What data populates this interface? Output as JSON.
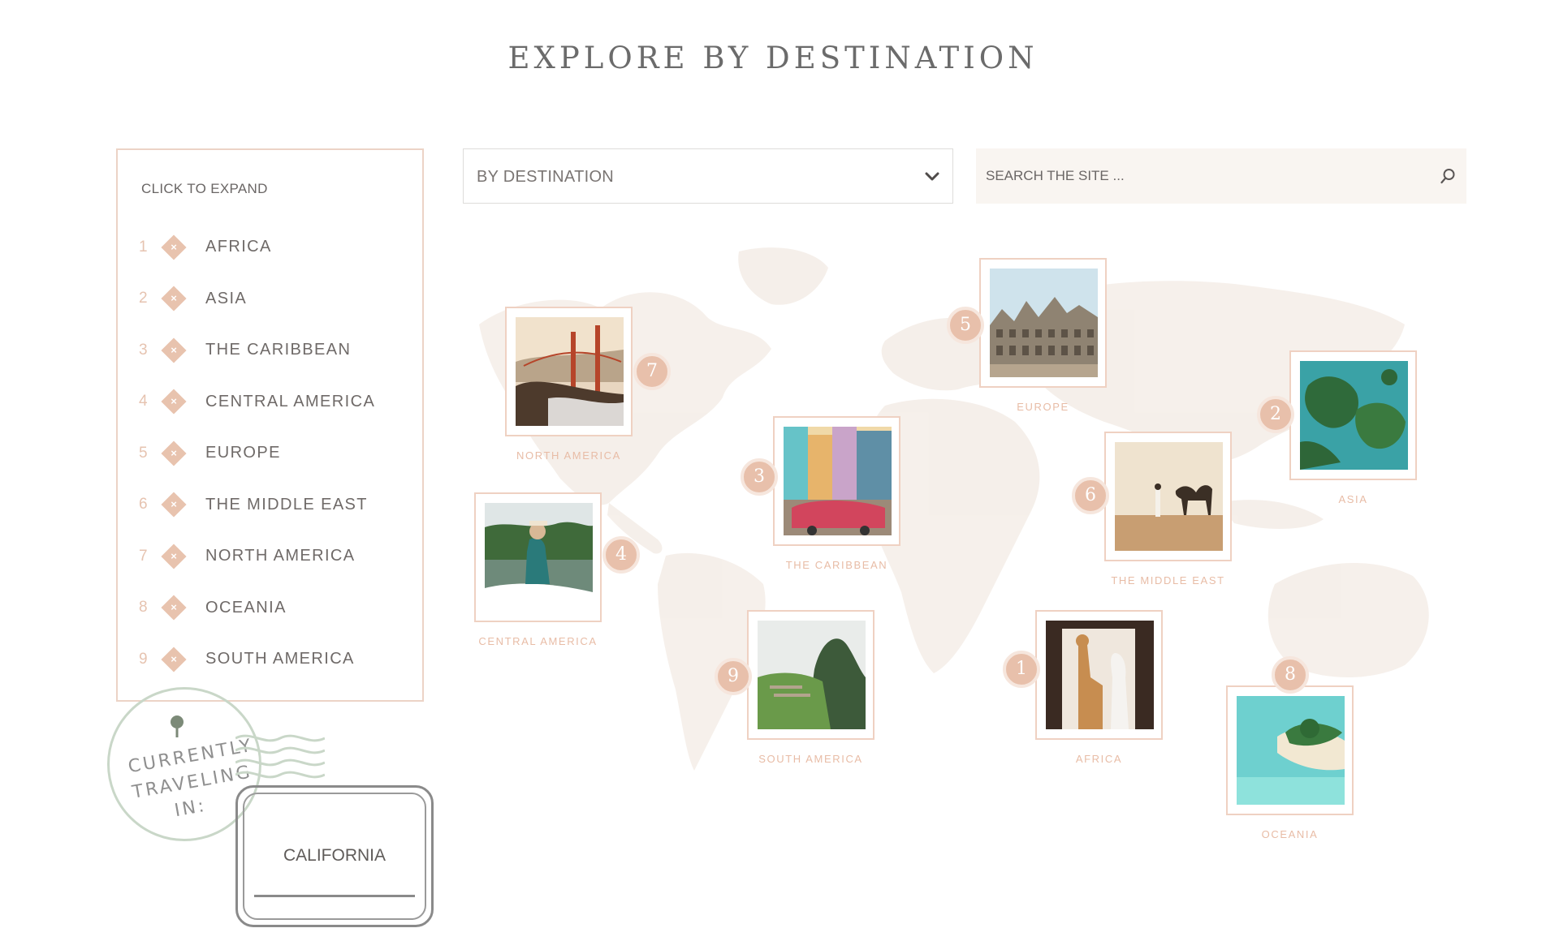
{
  "page": {
    "title": "EXPLORE BY DESTINATION"
  },
  "sidebar": {
    "heading": "CLICK TO EXPAND",
    "items": [
      {
        "num": "1",
        "label": "AFRICA"
      },
      {
        "num": "2",
        "label": "ASIA"
      },
      {
        "num": "3",
        "label": "THE CARIBBEAN"
      },
      {
        "num": "4",
        "label": "CENTRAL AMERICA"
      },
      {
        "num": "5",
        "label": "EUROPE"
      },
      {
        "num": "6",
        "label": "THE MIDDLE EAST"
      },
      {
        "num": "7",
        "label": "NORTH AMERICA"
      },
      {
        "num": "8",
        "label": "OCEANIA"
      },
      {
        "num": "9",
        "label": "SOUTH AMERICA"
      }
    ],
    "expand_icon": "x-icon"
  },
  "filter": {
    "selected": "BY DESTINATION",
    "icon": "chevron-down-icon"
  },
  "search": {
    "placeholder": "SEARCH THE SITE ...",
    "icon": "search-icon"
  },
  "map": {
    "cards": [
      {
        "num": "7",
        "caption": "NORTH AMERICA",
        "photo": "golden-gate-bridge"
      },
      {
        "num": "5",
        "caption": "EUROPE",
        "photo": "grand-place-buildings"
      },
      {
        "num": "2",
        "caption": "ASIA",
        "photo": "tropical-islands"
      },
      {
        "num": "3",
        "caption": "THE CARIBBEAN",
        "photo": "vintage-car-street"
      },
      {
        "num": "6",
        "caption": "THE MIDDLE EAST",
        "photo": "desert-camel"
      },
      {
        "num": "4",
        "caption": "CENTRAL AMERICA",
        "photo": "woman-on-boat"
      },
      {
        "num": "9",
        "caption": "SOUTH AMERICA",
        "photo": "machu-picchu"
      },
      {
        "num": "1",
        "caption": "AFRICA",
        "photo": "giraffe-window"
      },
      {
        "num": "8",
        "caption": "OCEANIA",
        "photo": "palm-island"
      }
    ]
  },
  "stamp": {
    "line1": "CURRENTLY",
    "line2": "TRAVELING",
    "line3": "IN:",
    "location": "CALIFORNIA",
    "icon": "map-pin-icon"
  },
  "colors": {
    "accent": "#e8c0ab",
    "border": "#ecd3c6",
    "text": "#6f6a68",
    "search_bg": "#f9f5f1"
  }
}
